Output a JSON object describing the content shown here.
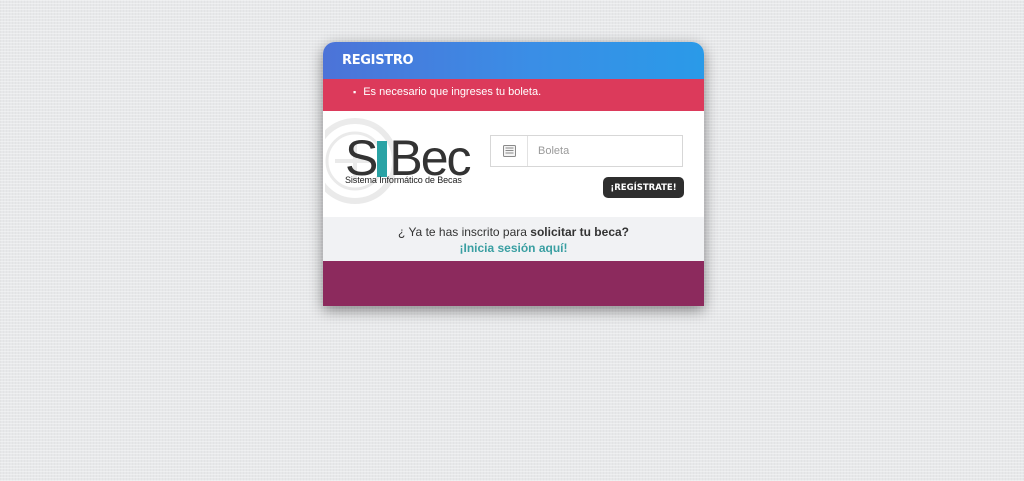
{
  "header": {
    "title": "REGISTRO"
  },
  "alert": {
    "messages": [
      "Es necesario que ingreses tu boleta."
    ]
  },
  "logo": {
    "word_s": "S",
    "word_rest": "Bec",
    "subtitle": "Sistema Informático de Becas"
  },
  "form": {
    "boleta_placeholder": "Boleta",
    "boleta_value": "",
    "register_label": "¡REGÍSTRATE!",
    "input_icon": "id-card-icon"
  },
  "footer": {
    "question_prefix": "¿ Ya te has inscrito para ",
    "question_strong": "solicitar tu beca?",
    "login_link": "¡Inicia sesión aquí!"
  },
  "colors": {
    "header_gradient": [
      "#4c73d8",
      "#2a9ae8"
    ],
    "alert_bg": "#dc3a5b",
    "button_bg": "#2e2e2e",
    "link": "#3a9fa2",
    "bottom_band": "#8c2a5d",
    "logo_accent": "#2aa3a5"
  }
}
